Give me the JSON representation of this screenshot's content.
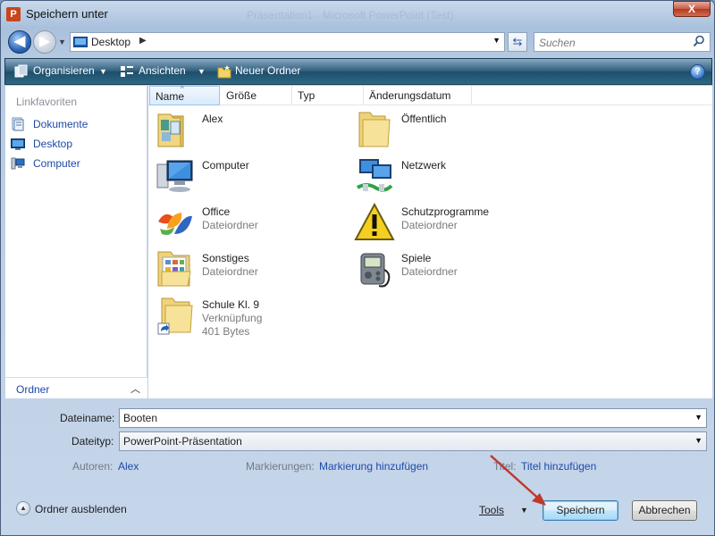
{
  "window": {
    "title": "Speichern unter",
    "background_title": "Präsentation1 - Microsoft PowerPoint (Test)",
    "close_label": "X",
    "app_icon_letter": "P"
  },
  "nav": {
    "back_glyph": "◀",
    "forward_glyph": "▶",
    "address": "Desktop",
    "search_placeholder": "Suchen"
  },
  "toolbar": {
    "organize": "Organisieren",
    "views": "Ansichten",
    "new_folder": "Neuer Ordner",
    "help": "?"
  },
  "sidebar": {
    "heading": "Linkfavoriten",
    "items": [
      {
        "label": "Dokumente",
        "icon": "documents-icon"
      },
      {
        "label": "Desktop",
        "icon": "desktop-icon"
      },
      {
        "label": "Computer",
        "icon": "computer-icon"
      }
    ],
    "folders_label": "Ordner"
  },
  "columns": [
    "Name",
    "Größe",
    "Typ",
    "Änderungsdatum"
  ],
  "items": [
    {
      "name": "Alex",
      "sub": "",
      "sub2": "",
      "icon": "user-folder-icon"
    },
    {
      "name": "Öffentlich",
      "sub": "",
      "sub2": "",
      "icon": "folder-icon"
    },
    {
      "name": "Computer",
      "sub": "",
      "sub2": "",
      "icon": "computer-icon"
    },
    {
      "name": "Netzwerk",
      "sub": "",
      "sub2": "",
      "icon": "network-icon"
    },
    {
      "name": "Office",
      "sub": "Dateiordner",
      "sub2": "",
      "icon": "office-logo-icon"
    },
    {
      "name": "Schutzprogramme",
      "sub": "Dateiordner",
      "sub2": "",
      "icon": "warning-icon"
    },
    {
      "name": "Sonstiges",
      "sub": "Dateiordner",
      "sub2": "",
      "icon": "folder-icon"
    },
    {
      "name": "Spiele",
      "sub": "Dateiordner",
      "sub2": "",
      "icon": "game-device-icon"
    },
    {
      "name": "Schule Kl. 9",
      "sub": "Verknüpfung",
      "sub2": "401 Bytes",
      "icon": "shortcut-folder-icon"
    }
  ],
  "form": {
    "filename_label": "Dateiname:",
    "filename_value": "Booten",
    "filetype_label": "Dateityp:",
    "filetype_value": "PowerPoint-Präsentation",
    "authors_label": "Autoren:",
    "authors_value": "Alex",
    "tags_label": "Markierungen:",
    "tags_value": "Markierung hinzufügen",
    "title_label": "Titel:",
    "title_value": "Titel hinzufügen"
  },
  "footer": {
    "hide_folders": "Ordner ausblenden",
    "tools": "Tools",
    "save": "Speichern",
    "cancel": "Abbrechen"
  },
  "colors": {
    "accent_link": "#1e4aa8",
    "annotation_arrow": "#c0392b"
  }
}
